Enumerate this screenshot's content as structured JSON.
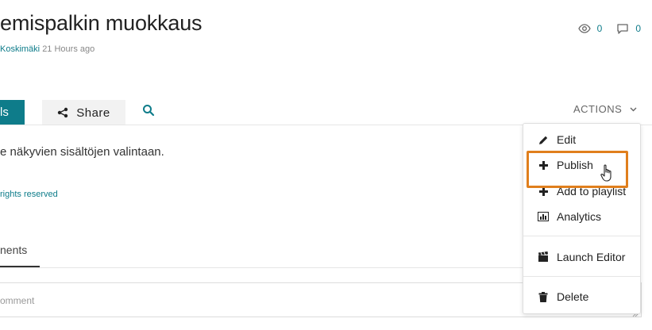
{
  "header": {
    "title": "emispalkin muokkaus",
    "author": "Koskimäki",
    "timestamp": "21 Hours ago"
  },
  "stats": {
    "views": "0",
    "comments": "0",
    "view_icon": "eye-icon",
    "comment_icon": "comment-icon"
  },
  "tabs": {
    "details_label": "ls",
    "share_label": "Share",
    "search_icon": "search-icon",
    "active_color": "#0e7c8a"
  },
  "actions": {
    "label": "ACTIONS"
  },
  "main": {
    "description": "e näkyvien sisältöjen valintaan.",
    "rights": "rights reserved",
    "comments_tab": "nents",
    "comment_placeholder": "omment"
  },
  "menu": {
    "items": [
      {
        "label": "Edit",
        "icon": "pencil-icon"
      },
      {
        "label": "Publish",
        "icon": "plus-icon"
      },
      {
        "label": "Add to playlist",
        "icon": "plus-icon"
      },
      {
        "label": "Analytics",
        "icon": "bar-chart-icon"
      },
      {
        "label": "Launch Editor",
        "icon": "clapperboard-icon"
      },
      {
        "label": "Delete",
        "icon": "trash-icon"
      }
    ],
    "highlight_color": "#e07f1d"
  }
}
